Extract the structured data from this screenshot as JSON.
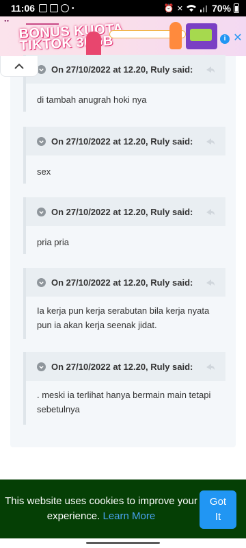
{
  "status_bar": {
    "time": "11:06",
    "battery": "70%"
  },
  "ad": {
    "title_line1": "BONUS KUOTA",
    "title_line2": "TIKTOK 30GB",
    "info_icon": "info-icon",
    "close_icon": "close-icon"
  },
  "comments": [
    {
      "meta": "On 27/10/2022 at 12.20, Ruly said:",
      "body": "di tambah anugrah hoki nya"
    },
    {
      "meta": "On 27/10/2022 at 12.20, Ruly said:",
      "body": "sex"
    },
    {
      "meta": "On 27/10/2022 at 12.20, Ruly said:",
      "body": "pria pria"
    },
    {
      "meta": "On 27/10/2022 at 12.20, Ruly said:",
      "body": "Ia kerja pun kerja serabutan bila kerja nyata pun ia akan kerja seenak jidat."
    },
    {
      "meta": "On 27/10/2022 at 12.20, Ruly said:",
      "body": ". meski ia terlihat hanya bermain main tetapi sebetulnya"
    }
  ],
  "cookie_bar": {
    "text": "This website uses cookies to improve your experience.",
    "link": "Learn More",
    "button_line1": "Got",
    "button_line2": "It"
  },
  "colors": {
    "cookie_bg": "#053f05",
    "accent": "#2196f3"
  }
}
